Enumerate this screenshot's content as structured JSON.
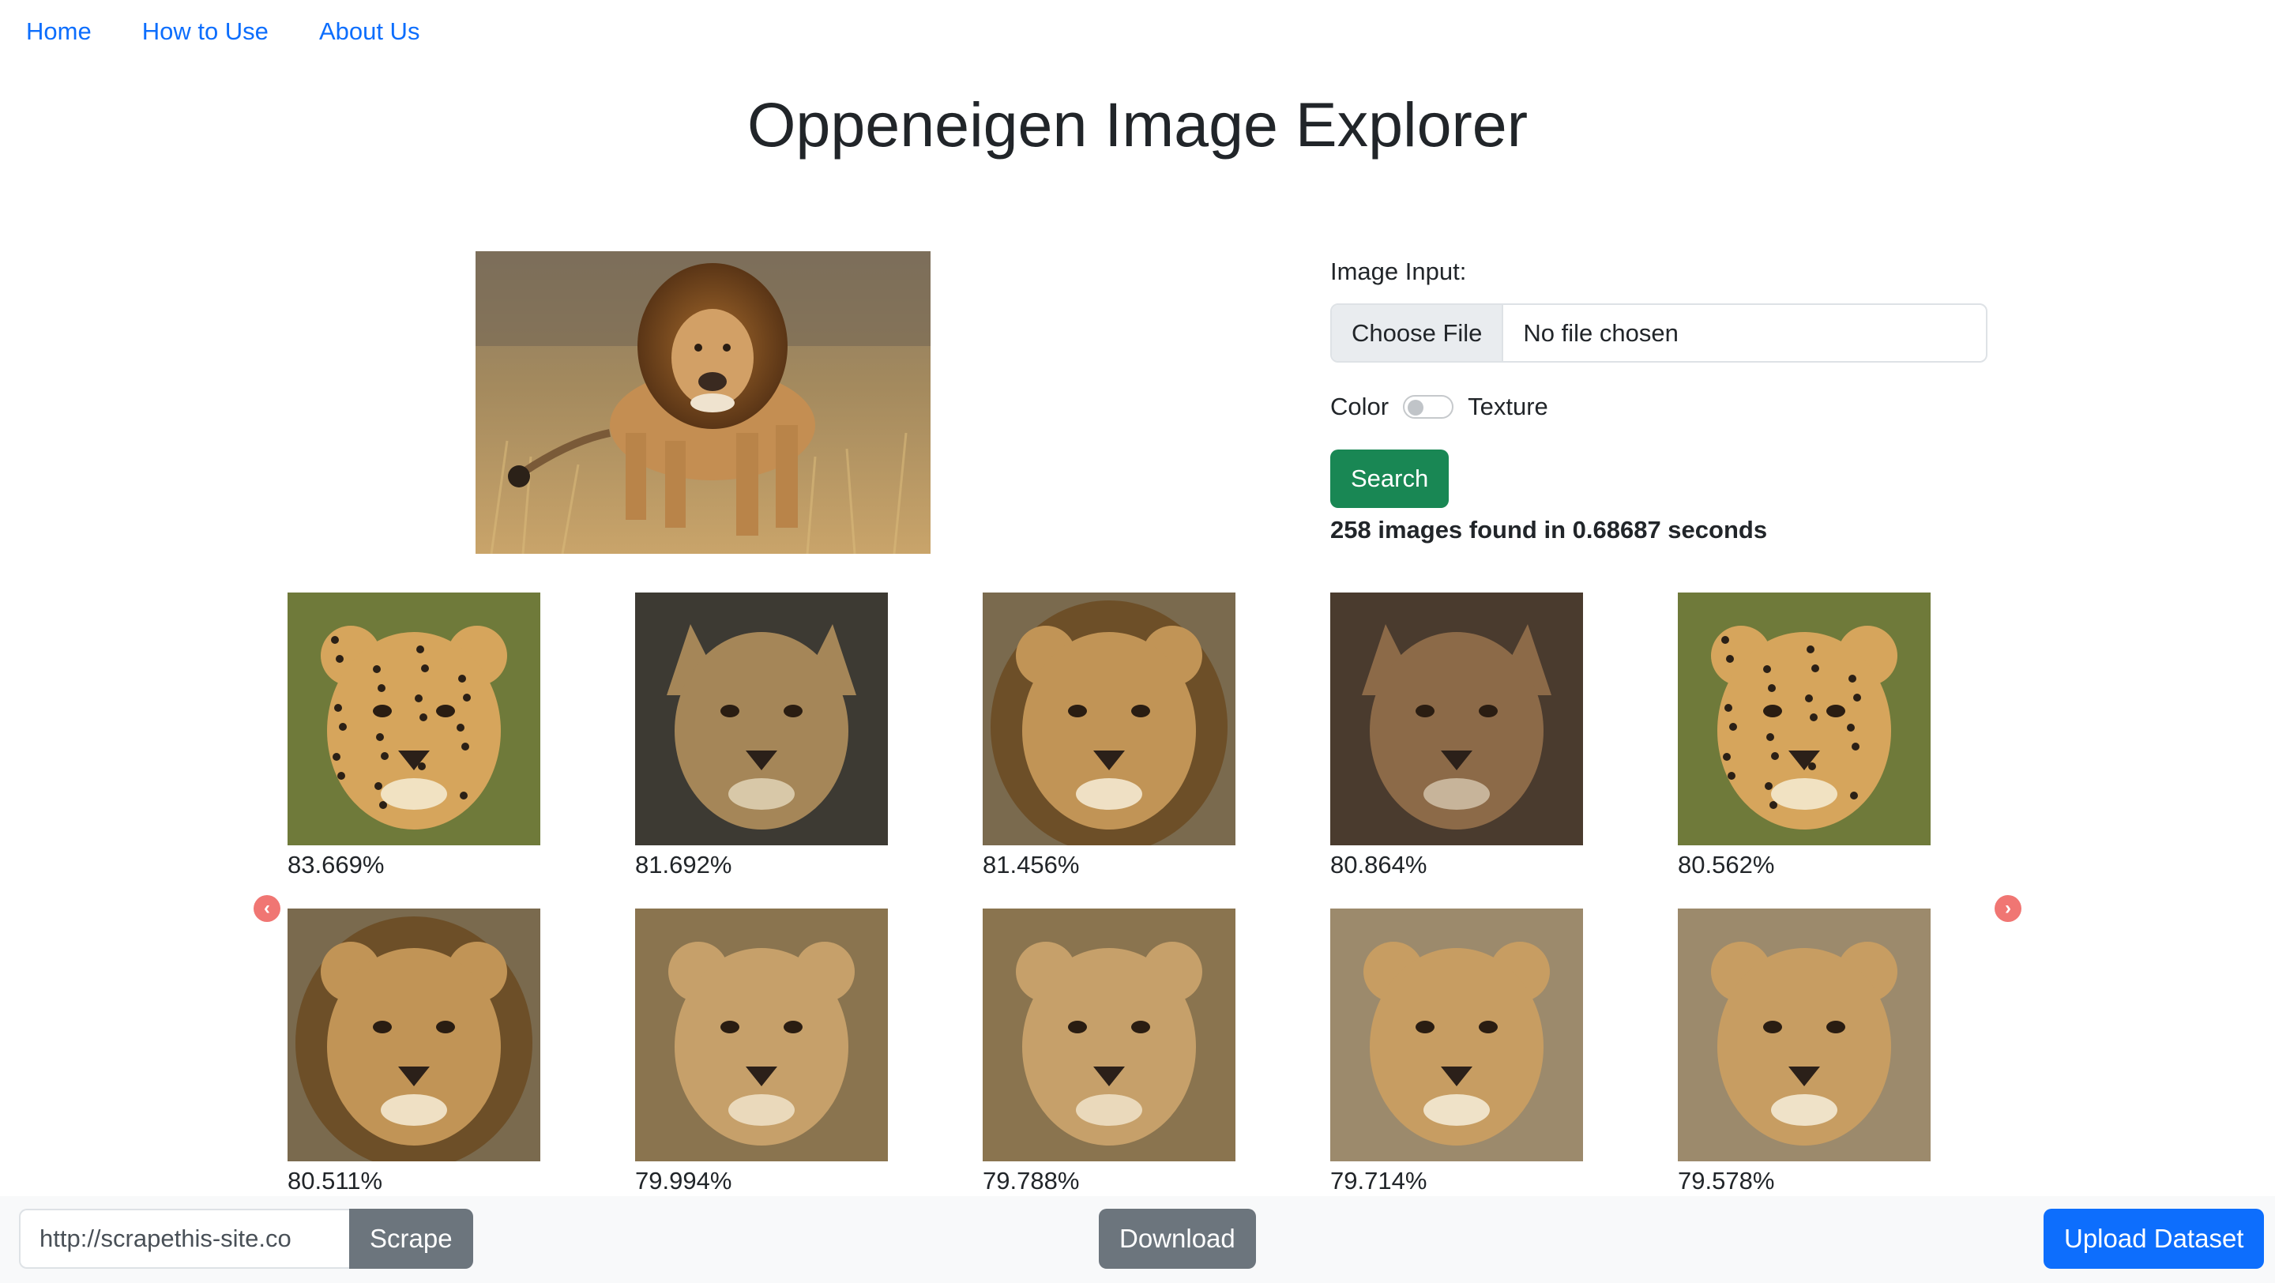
{
  "nav": {
    "items": [
      {
        "label": "Home"
      },
      {
        "label": "How to Use"
      },
      {
        "label": "About Us"
      }
    ]
  },
  "page_title": "Oppeneigen Image Explorer",
  "form": {
    "image_input_label": "Image Input:",
    "choose_file_label": "Choose File",
    "file_status": "No file chosen",
    "toggle_left_label": "Color",
    "toggle_right_label": "Texture",
    "toggle_on": false,
    "search_label": "Search",
    "result_summary": "258 images found in 0.68687 seconds"
  },
  "results": [
    {
      "score": "83.669%",
      "subject": "cheetah"
    },
    {
      "score": "81.692%",
      "subject": "fox"
    },
    {
      "score": "81.456%",
      "subject": "lion"
    },
    {
      "score": "80.864%",
      "subject": "jackal"
    },
    {
      "score": "80.562%",
      "subject": "cheetah"
    },
    {
      "score": "80.511%",
      "subject": "lion"
    },
    {
      "score": "79.994%",
      "subject": "lioness"
    },
    {
      "score": "79.788%",
      "subject": "lioness"
    },
    {
      "score": "79.714%",
      "subject": "lion-cub"
    },
    {
      "score": "79.578%",
      "subject": "lion-cub"
    }
  ],
  "carousel": {
    "prev_icon": "chevron-left-icon",
    "next_icon": "chevron-right-icon"
  },
  "bottom_bar": {
    "url_value": "http://scrapethis-site.co",
    "scrape_label": "Scrape",
    "download_label": "Download",
    "upload_label": "Upload Dataset"
  },
  "colors": {
    "link": "#0d6efd",
    "search_button": "#198754",
    "secondary_button": "#6c757d",
    "primary_button": "#0d6efd",
    "carousel_arrow": "#f07673"
  }
}
